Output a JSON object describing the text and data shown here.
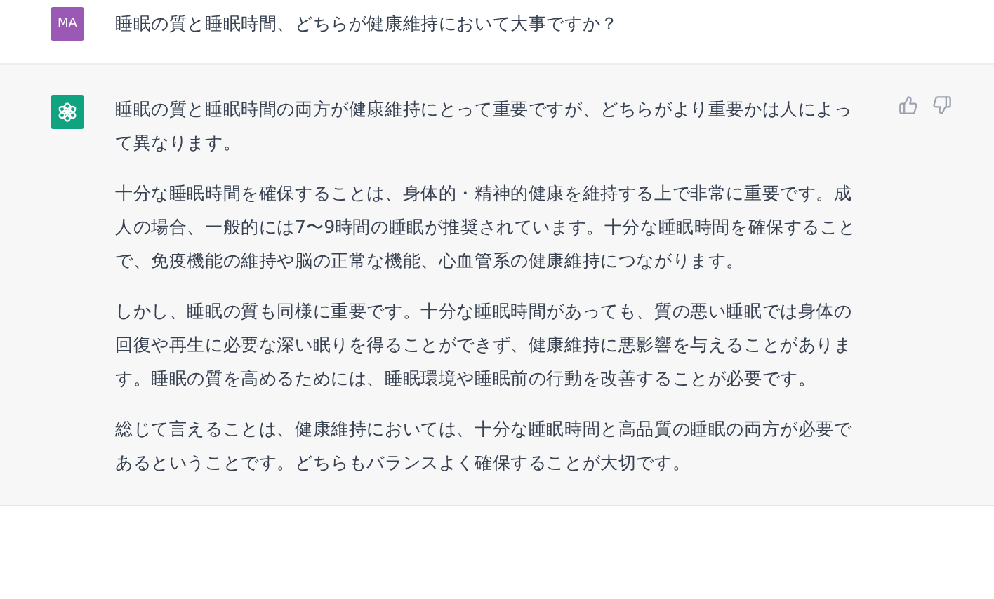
{
  "messages": [
    {
      "kind": "user",
      "avatar": "MA",
      "paragraphs": [
        "睡眠の質と睡眠時間、どちらが健康維持において大事ですか？"
      ]
    },
    {
      "kind": "assistant",
      "paragraphs": [
        "睡眠の質と睡眠時間の両方が健康維持にとって重要ですが、どちらがより重要かは人によって異なります。",
        "十分な睡眠時間を確保することは、身体的・精神的健康を維持する上で非常に重要です。成人の場合、一般的には7〜9時間の睡眠が推奨されています。十分な睡眠時間を確保することで、免疫機能の維持や脳の正常な機能、心血管系の健康維持につながります。",
        "しかし、睡眠の質も同様に重要です。十分な睡眠時間があっても、質の悪い睡眠では身体の回復や再生に必要な深い眠りを得ることができず、健康維持に悪影響を与えることがあります。睡眠の質を高めるためには、睡眠環境や睡眠前の行動を改善することが必要です。",
        "総じて言えることは、健康維持においては、十分な睡眠時間と高品質の睡眠の両方が必要であるということです。どちらもバランスよく確保することが大切です。"
      ]
    }
  ]
}
